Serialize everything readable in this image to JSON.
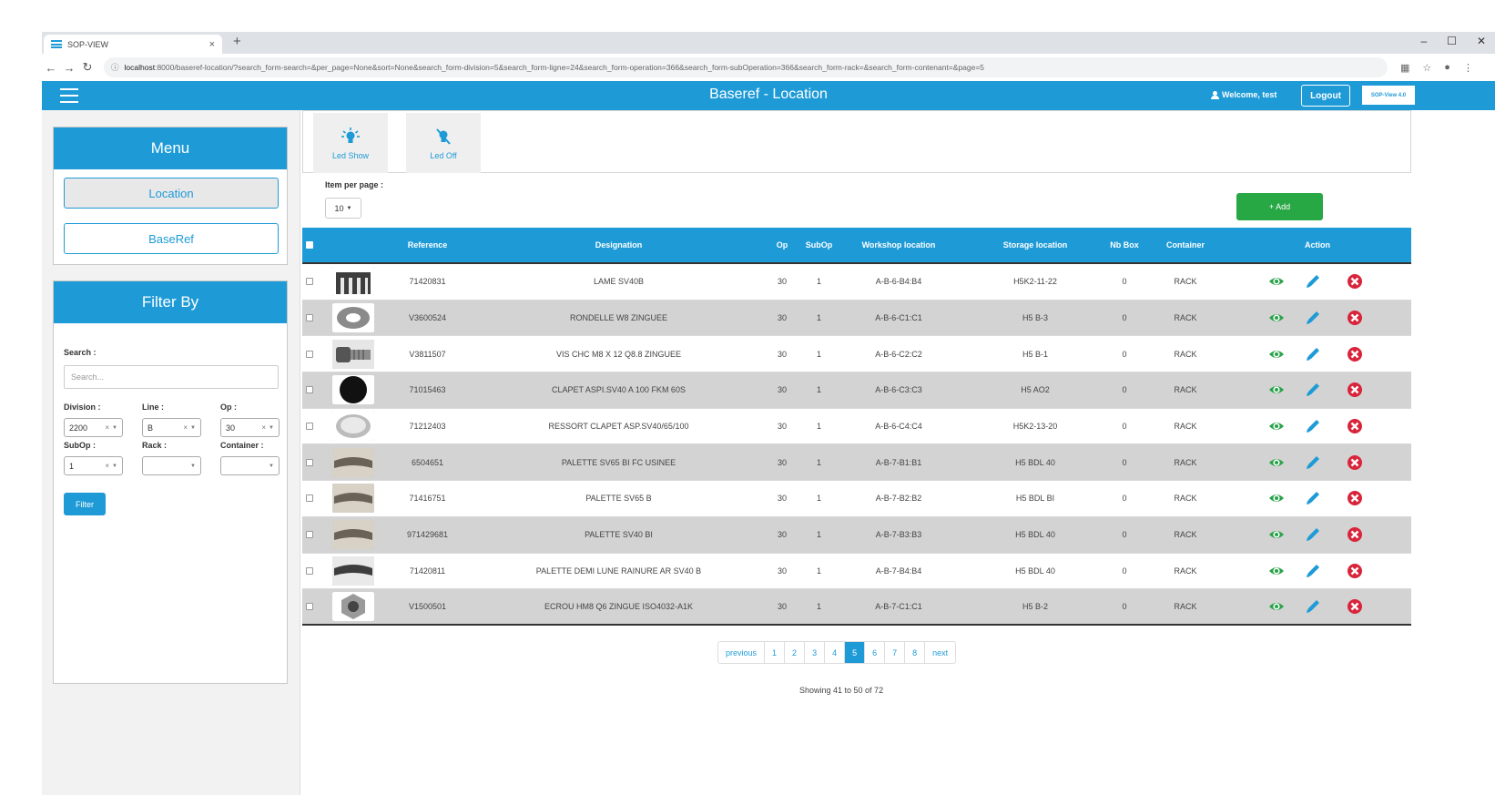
{
  "browser": {
    "tab_title": "SOP-VIEW",
    "tab_close": "×",
    "new_tab": "+",
    "url_host": "localhost",
    "url_rest": ":8000/baseref-location/?search_form-search=&per_page=None&sort=None&search_form-division=5&search_form-ligne=24&search_form-operation=366&search_form-subOperation=366&search_form-rack=&search_form-contenant=&page=5",
    "window_controls": [
      "–",
      "☐",
      "✕"
    ]
  },
  "header": {
    "title": "Baseref - Location",
    "welcome": "Welcome, test",
    "logout": "Logout",
    "brand": "SOP-View 4.0"
  },
  "menu": {
    "title": "Menu",
    "items": [
      {
        "label": "Location"
      },
      {
        "label": "BaseRef"
      }
    ]
  },
  "filter": {
    "title": "Filter By",
    "search_label": "Search :",
    "search_placeholder": "Search...",
    "division_label": "Division :",
    "division_value": "2200",
    "line_label": "Line :",
    "line_value": "B",
    "op_label": "Op :",
    "op_value": "30",
    "subop_label": "SubOp :",
    "subop_value": "1",
    "rack_label": "Rack :",
    "rack_value": "",
    "container_label": "Container :",
    "container_value": "",
    "button": "Filter"
  },
  "toolbar": {
    "led_show": "Led Show",
    "led_off": "Led Off"
  },
  "list": {
    "per_page_label": "Item per page :",
    "per_page_value": "10",
    "add_button": "+ Add"
  },
  "table": {
    "headers": {
      "reference": "Reference",
      "designation": "Designation",
      "op": "Op",
      "subop": "SubOp",
      "workshop": "Workshop location",
      "storage": "Storage location",
      "nbbox": "Nb Box",
      "container": "Container",
      "action": "Action"
    },
    "rows": [
      {
        "reference": "71420831",
        "designation": "LAME SV40B",
        "op": "30",
        "subop": "1",
        "workshop": "A-B-6-B4:B4",
        "storage": "H5K2-11-22",
        "nbbox": "0",
        "container": "RACK",
        "thumb": "comb-blade"
      },
      {
        "reference": "V3600524",
        "designation": "RONDELLE W8 ZINGUEE",
        "op": "30",
        "subop": "1",
        "workshop": "A-B-6-C1:C1",
        "storage": "H5 B-3",
        "nbbox": "0",
        "container": "RACK",
        "thumb": "washer"
      },
      {
        "reference": "V3811507",
        "designation": "VIS CHC M8 X 12 Q8.8 ZINGUEE",
        "op": "30",
        "subop": "1",
        "workshop": "A-B-6-C2:C2",
        "storage": "H5 B-1",
        "nbbox": "0",
        "container": "RACK",
        "thumb": "screw"
      },
      {
        "reference": "71015463",
        "designation": "CLAPET ASPI.SV40 A 100 FKM 60S",
        "op": "30",
        "subop": "1",
        "workshop": "A-B-6-C3:C3",
        "storage": "H5 AO2",
        "nbbox": "0",
        "container": "RACK",
        "thumb": "black-disc"
      },
      {
        "reference": "71212403",
        "designation": "RESSORT CLAPET ASP.SV40/65/100",
        "op": "30",
        "subop": "1",
        "workshop": "A-B-6-C4:C4",
        "storage": "H5K2-13-20",
        "nbbox": "0",
        "container": "RACK",
        "thumb": "ring"
      },
      {
        "reference": "6504651",
        "designation": "PALETTE SV65 BI FC USINEE",
        "op": "30",
        "subop": "1",
        "workshop": "A-B-7-B1:B1",
        "storage": "H5 BDL 40",
        "nbbox": "0",
        "container": "RACK",
        "thumb": "vane"
      },
      {
        "reference": "71416751",
        "designation": "PALETTE SV65 B",
        "op": "30",
        "subop": "1",
        "workshop": "A-B-7-B2:B2",
        "storage": "H5 BDL BI",
        "nbbox": "0",
        "container": "RACK",
        "thumb": "vane"
      },
      {
        "reference": "971429681",
        "designation": "PALETTE SV40 BI",
        "op": "30",
        "subop": "1",
        "workshop": "A-B-7-B3:B3",
        "storage": "H5 BDL 40",
        "nbbox": "0",
        "container": "RACK",
        "thumb": "vane"
      },
      {
        "reference": "71420811",
        "designation": "PALETTE DEMI LUNE RAINURE AR SV40 B",
        "op": "30",
        "subop": "1",
        "workshop": "A-B-7-B4:B4",
        "storage": "H5 BDL 40",
        "nbbox": "0",
        "container": "RACK",
        "thumb": "vane-dark"
      },
      {
        "reference": "V1500501",
        "designation": "ECROU HM8 Q6 ZINGUE ISO4032-A1K",
        "op": "30",
        "subop": "1",
        "workshop": "A-B-7-C1:C1",
        "storage": "H5 B-2",
        "nbbox": "0",
        "container": "RACK",
        "thumb": "nut"
      }
    ]
  },
  "pagination": {
    "previous": "previous",
    "pages": [
      "1",
      "2",
      "3",
      "4",
      "5",
      "6",
      "7",
      "8"
    ],
    "active": "5",
    "next": "next",
    "showing": "Showing 41 to 50 of 72"
  },
  "colors": {
    "primary": "#1e9bd7",
    "success": "#28a745",
    "danger": "#d9253b",
    "view": "#2aa24a"
  }
}
